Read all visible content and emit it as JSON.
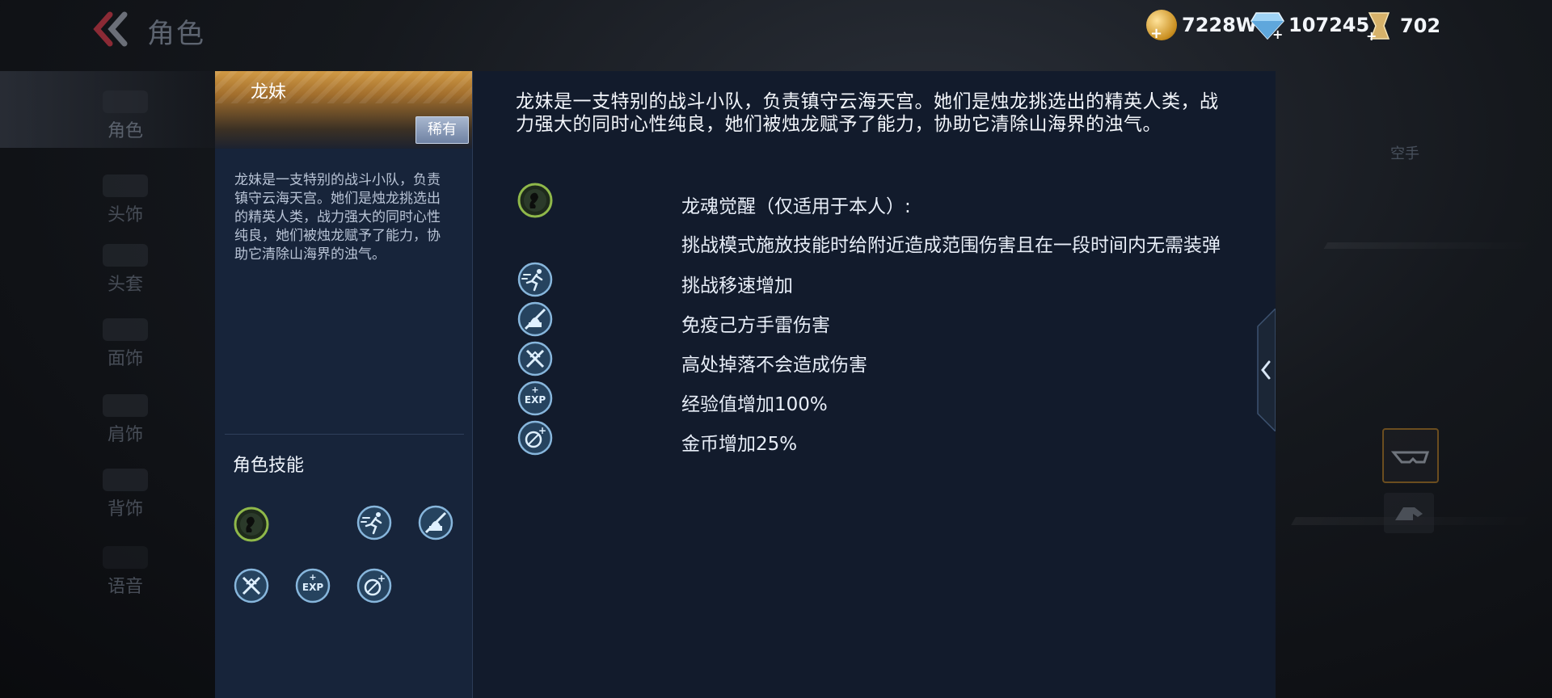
{
  "header": {
    "title": "角色",
    "currencies": [
      {
        "name": "gold",
        "value": "7228W"
      },
      {
        "name": "diamond",
        "value": "107245"
      },
      {
        "name": "ticket",
        "value": "702"
      }
    ]
  },
  "sidebar": {
    "items": [
      {
        "label": "角色",
        "icon": "character-icon",
        "active": true
      },
      {
        "label": "头饰",
        "icon": "headwear-icon"
      },
      {
        "label": "头套",
        "icon": "headgear-icon"
      },
      {
        "label": "面饰",
        "icon": "face-accessory-icon"
      },
      {
        "label": "肩饰",
        "icon": "shoulder-accessory-icon"
      },
      {
        "label": "背饰",
        "icon": "back-accessory-icon"
      },
      {
        "label": "语音",
        "icon": "voice-icon"
      }
    ]
  },
  "hero": {
    "name": "龙妹",
    "rarity": "稀有",
    "short_desc": "龙妹是一支特别的战斗小队，负责镇守云海天宫。她们是烛龙挑选出的精英人类，战力强大的同时心性纯良，她们被烛龙赋予了能力，协助它清除山海界的浊气。",
    "skills_title": "角色技能",
    "long_desc": "龙妹是一支特别的战斗小队，负责镇守云海天宫。她们是烛龙挑选出的精英人类，战力强大的同时心性纯良，她们被烛龙赋予了能力，协助它清除山海界的浊气。"
  },
  "skills": [
    {
      "icon": "dragon-soul-icon",
      "title": "龙魂觉醒（仅适用于本人）:",
      "detail": "挑战模式施放技能时给附近造成范围伤害且在一段时间内无需装弹"
    },
    {
      "icon": "run-speed-icon",
      "title": "挑战移速增加"
    },
    {
      "icon": "grenade-immune-icon",
      "title": "免疫己方手雷伤害"
    },
    {
      "icon": "fall-immune-icon",
      "title": "高处掉落不会造成伤害"
    },
    {
      "icon": "exp-boost-icon",
      "title": "经验值增加100%"
    },
    {
      "icon": "coin-boost-icon",
      "title": "金币增加25%"
    }
  ],
  "right_side": {
    "label": "空手"
  },
  "colors": {
    "accent_gold": "#d19a45",
    "panel": "#17243a",
    "panel_right": "#121b2c"
  }
}
